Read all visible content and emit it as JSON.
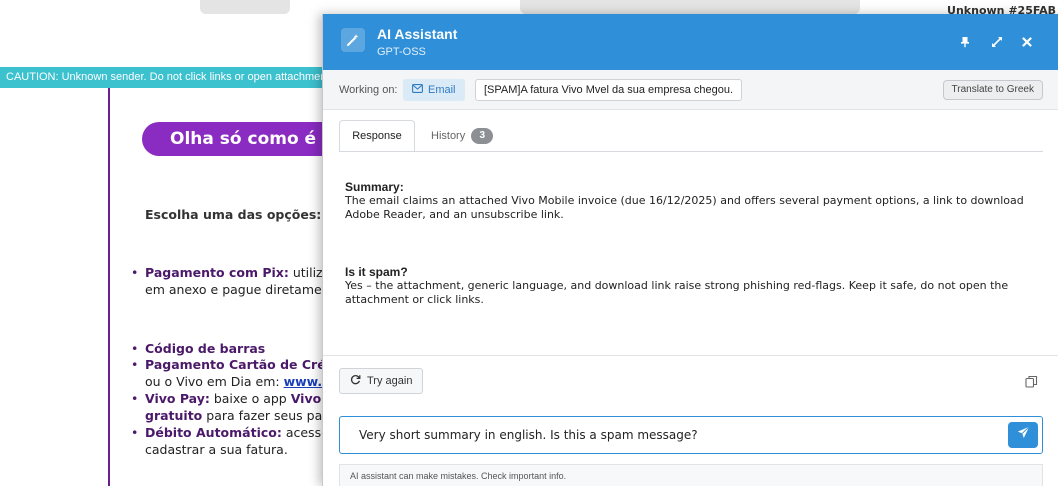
{
  "background": {
    "top_right_tag": "Unknown  #25FAB",
    "caution_banner": "CAUTION: Unknown sender. Do not click links or open attachments unless you recognize the sender and know the content is safe.",
    "pill_title": "Olha só como é fácil",
    "choose_option": "Escolha uma das opções:",
    "pix_label": "Pagamento com Pix:",
    "pix_text": " utilize",
    "pix_text2": "em anexo e pague diretame",
    "barcode_label": "Código de barras",
    "card_label": "Pagamento Cartão de Créd",
    "card_text_prefix": "ou o Vivo em Dia em: ",
    "card_link": "www.",
    "vivopay_label": "Vivo Pay:",
    "vivopay_text": " baixe o app ",
    "vivopay_text_bold": "Vivo",
    "vivopay_line2_bold": "gratuito",
    "vivopay_line2": " para fazer seus pag",
    "debit_label": "Débito Automático:",
    "debit_text": " acesse",
    "debit_text2": "cadastrar a sua fatura."
  },
  "panel": {
    "title": "AI Assistant",
    "subtitle": "GPT-OSS",
    "working_on_label": "Working on:",
    "email_chip_label": "Email",
    "subject": "[SPAM]A fatura Vivo Mvel da sua empresa chegou.",
    "translate_button": "Translate to Greek",
    "tabs": {
      "response": "Response",
      "history": "History",
      "history_count": "3"
    },
    "response": {
      "summary_heading": "Summary:",
      "summary_text": "The email claims an attached Vivo Mobile invoice (due 16/12/2025) and offers several payment options, a link to download Adobe Reader, and an unsubscribe link.",
      "spam_heading": "Is it spam?",
      "spam_text": "Yes – the attachment, generic language, and download link raise strong phishing red-flags. Keep it safe, do not open the attachment or click links."
    },
    "try_again": "Try again",
    "input_value": "Very short summary in english. Is this a spam message?",
    "disclaimer": "AI assistant can make mistakes. Check important info."
  },
  "colors": {
    "header_blue": "#2f8fd8",
    "caution_teal": "#3cc1cf",
    "email_purple": "#8a2bc2"
  }
}
